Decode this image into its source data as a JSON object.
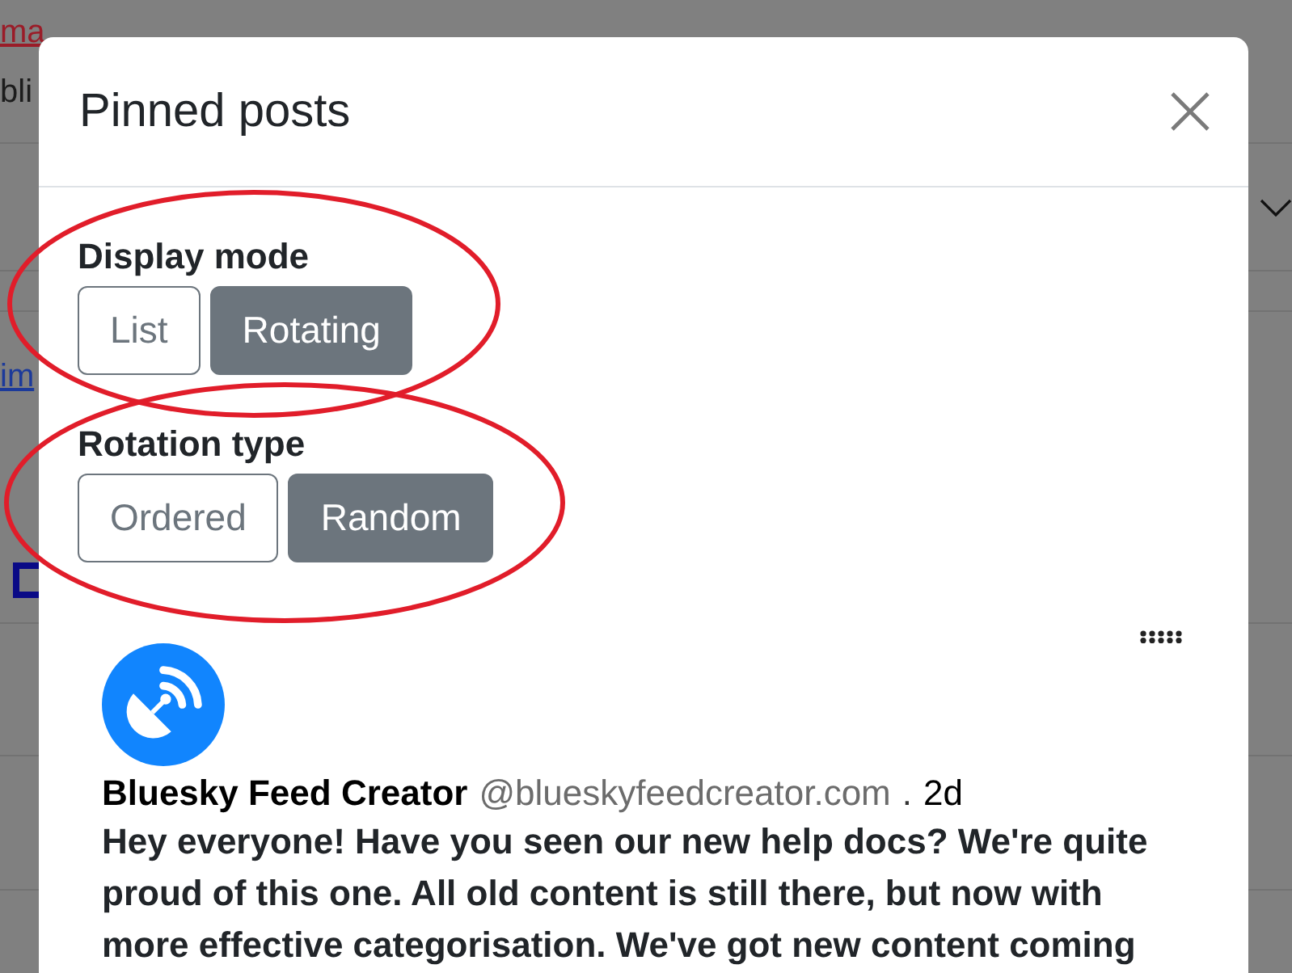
{
  "background_page": {
    "fragments": [
      {
        "kind": "danger-link",
        "text": "ma"
      },
      {
        "kind": "text",
        "text": "bli"
      },
      {
        "kind": "link",
        "text": "im"
      }
    ]
  },
  "dialog": {
    "title": "Pinned posts"
  },
  "settings": [
    {
      "label": "Display mode",
      "options": [
        {
          "label": "List",
          "selected": false
        },
        {
          "label": "Rotating",
          "selected": true
        }
      ]
    },
    {
      "label": "Rotation type",
      "options": [
        {
          "label": "Ordered",
          "selected": false
        },
        {
          "label": "Random",
          "selected": true
        }
      ]
    }
  ],
  "post": {
    "author_name": "Bluesky Feed Creator",
    "handle": "@blueskyfeedcreator.com",
    "separator": ".",
    "age": "2d",
    "text_lines": [
      "Hey everyone! Have you seen our new help docs? We're quite",
      "proud of this one. All old content is still there, but now with",
      "more effective categorisation. We've got new content coming"
    ]
  }
}
